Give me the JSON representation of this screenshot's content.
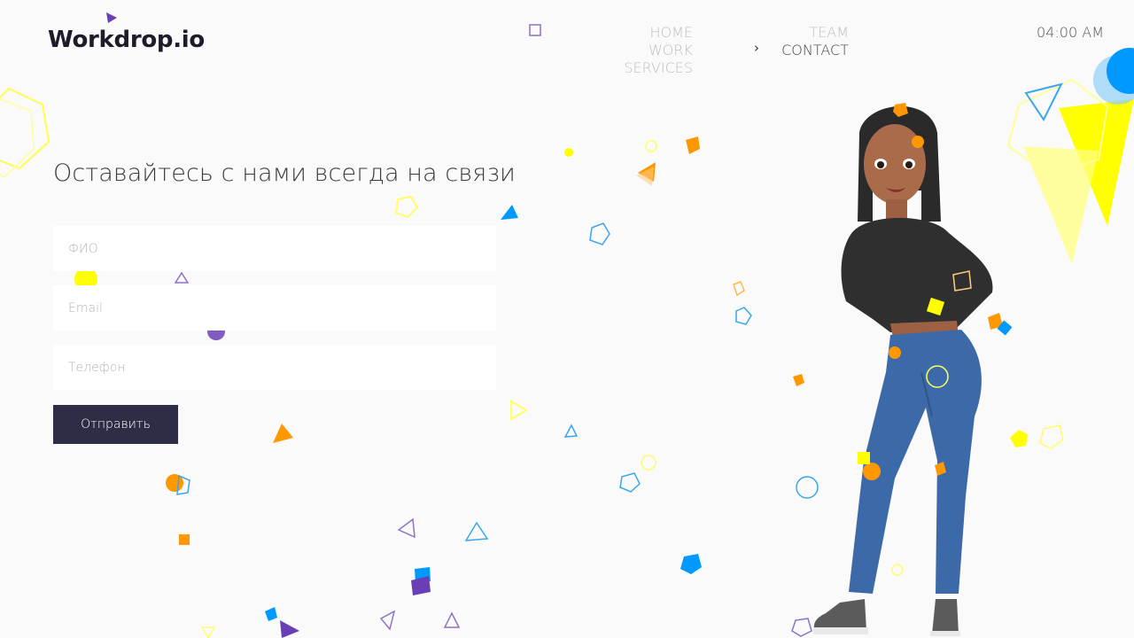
{
  "brand": {
    "name": "Workdrop.io"
  },
  "nav": {
    "left": [
      {
        "label": "HOME",
        "active": false
      },
      {
        "label": "WORK",
        "active": false
      },
      {
        "label": "SERVICES",
        "active": false
      }
    ],
    "right": [
      {
        "label": "TEAM",
        "active": false
      },
      {
        "label": "CONTACT",
        "active": true
      }
    ]
  },
  "clock": {
    "time": "04:00 AM"
  },
  "contact": {
    "heading": "Оставайтесь с нами всегда на связи",
    "fields": {
      "name_placeholder": "ФИО",
      "email_placeholder": "Email",
      "phone_placeholder": "Телефон"
    },
    "submit_label": "Отправить"
  },
  "colors": {
    "accent_dark": "#2e2d48",
    "yellow": "#ffff00",
    "orange": "#ff9800",
    "blue": "#0099ff",
    "purple": "#6a3fb5"
  },
  "icons": {
    "nav_indicator": "chevron-right-icon",
    "logo_mark": "triangle-icon"
  }
}
